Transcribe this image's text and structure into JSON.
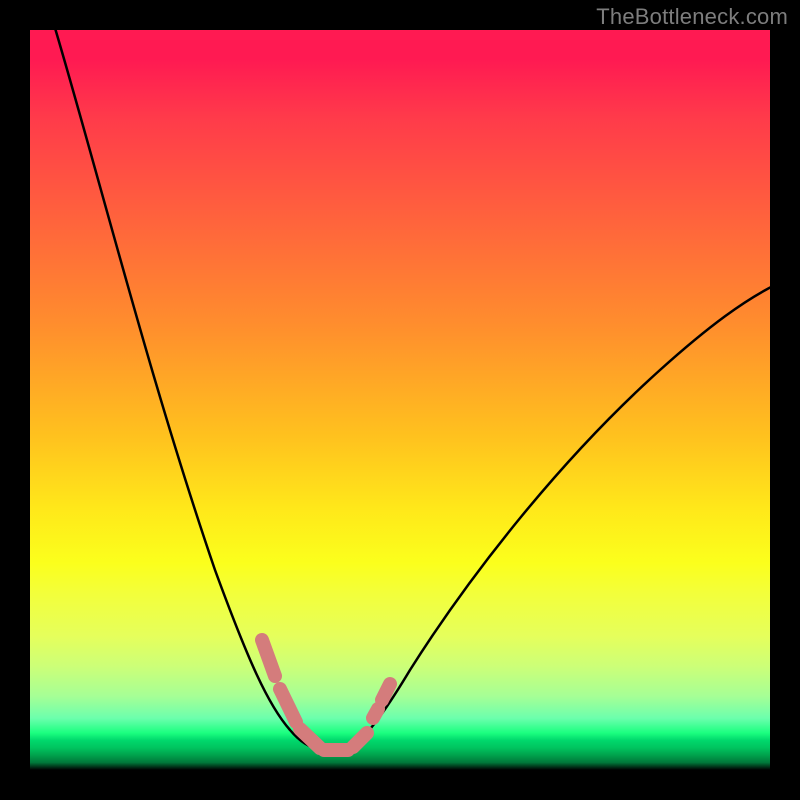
{
  "watermark": "TheBottleneck.com",
  "colors": {
    "background": "#000000",
    "gradient_top": "#ff1a52",
    "gradient_bottom": "#00783a",
    "curve": "#000000",
    "marker": "#d47c7c"
  },
  "chart_data": {
    "type": "line",
    "title": "",
    "xlabel": "",
    "ylabel": "",
    "xlim": [
      0,
      100
    ],
    "ylim": [
      0,
      100
    ],
    "grid": false,
    "series": [
      {
        "name": "descending-curve",
        "x": [
          0,
          5,
          10,
          15,
          20,
          25,
          28,
          30,
          33,
          36,
          38,
          40
        ],
        "y": [
          100,
          86,
          72,
          58,
          44,
          30,
          20,
          15,
          10,
          6,
          3.5,
          3
        ]
      },
      {
        "name": "ascending-curve",
        "x": [
          40,
          42,
          45,
          50,
          55,
          60,
          65,
          70,
          75,
          80,
          85,
          90,
          95,
          100
        ],
        "y": [
          3,
          3.5,
          5,
          10,
          17,
          25,
          33,
          40,
          47,
          53,
          58,
          63,
          67,
          70
        ]
      }
    ],
    "markers": {
      "name": "highlighted-segments",
      "style": "thick-pink-strokes",
      "points_x": [
        28.0,
        31.5,
        33.5,
        36.5,
        39.5,
        42.5,
        43.5
      ],
      "points_y": [
        16.0,
        9.0,
        6.5,
        3.8,
        3.2,
        4.2,
        7.2
      ]
    },
    "minimum": {
      "x": 38,
      "y": 3
    }
  }
}
